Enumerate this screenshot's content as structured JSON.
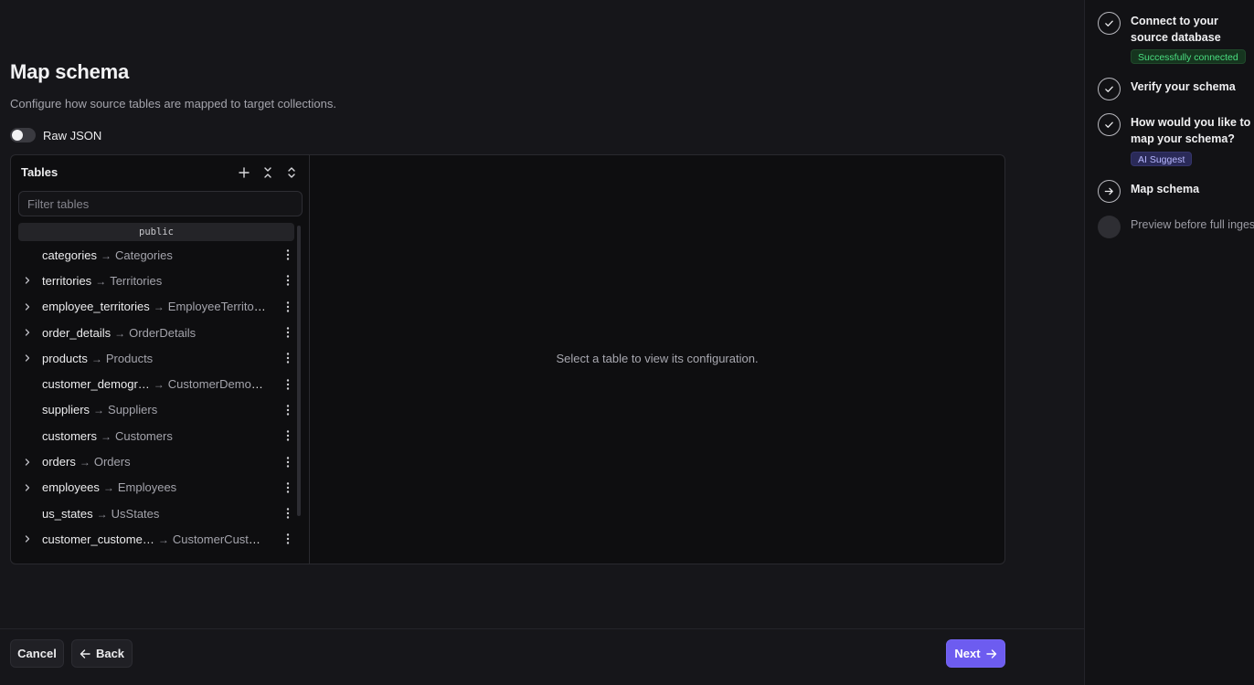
{
  "page": {
    "title": "Map schema",
    "description": "Configure how source tables are mapped to target collections.",
    "raw_json_label": "Raw JSON"
  },
  "tables_panel": {
    "header": "Tables",
    "filter_placeholder": "Filter tables",
    "schema": "public",
    "arrow": "→",
    "rows": [
      {
        "source": "categories",
        "target": "Categories",
        "expandable": false
      },
      {
        "source": "territories",
        "target": "Territories",
        "expandable": true
      },
      {
        "source": "employee_territories",
        "target": "EmployeeTerritories",
        "expandable": true
      },
      {
        "source": "order_details",
        "target": "OrderDetails",
        "expandable": true
      },
      {
        "source": "products",
        "target": "Products",
        "expandable": true
      },
      {
        "source": "customer_demogr…",
        "target": "CustomerDemogra…",
        "expandable": false
      },
      {
        "source": "suppliers",
        "target": "Suppliers",
        "expandable": false
      },
      {
        "source": "customers",
        "target": "Customers",
        "expandable": false
      },
      {
        "source": "orders",
        "target": "Orders",
        "expandable": true
      },
      {
        "source": "employees",
        "target": "Employees",
        "expandable": true
      },
      {
        "source": "us_states",
        "target": "UsStates",
        "expandable": false
      },
      {
        "source": "customer_custome…",
        "target": "CustomerCustom…",
        "expandable": true
      }
    ]
  },
  "detail": {
    "empty_message": "Select a table to view its configuration."
  },
  "footer": {
    "cancel_label": "Cancel",
    "back_label": "Back",
    "next_label": "Next"
  },
  "steps": [
    {
      "title": "Connect to your source database",
      "status": "done",
      "badge": "Successfully connected"
    },
    {
      "title": "Verify your schema",
      "status": "done"
    },
    {
      "title": "How would you like to map your schema?",
      "status": "done",
      "badge": "AI Suggest"
    },
    {
      "title": "Map schema",
      "status": "current"
    },
    {
      "title": "Preview before full ingest",
      "status": "pending"
    }
  ],
  "colors": {
    "accent": "#6d5cf0",
    "success": "#4ade80",
    "badge_purple": "#b7b7ff"
  }
}
